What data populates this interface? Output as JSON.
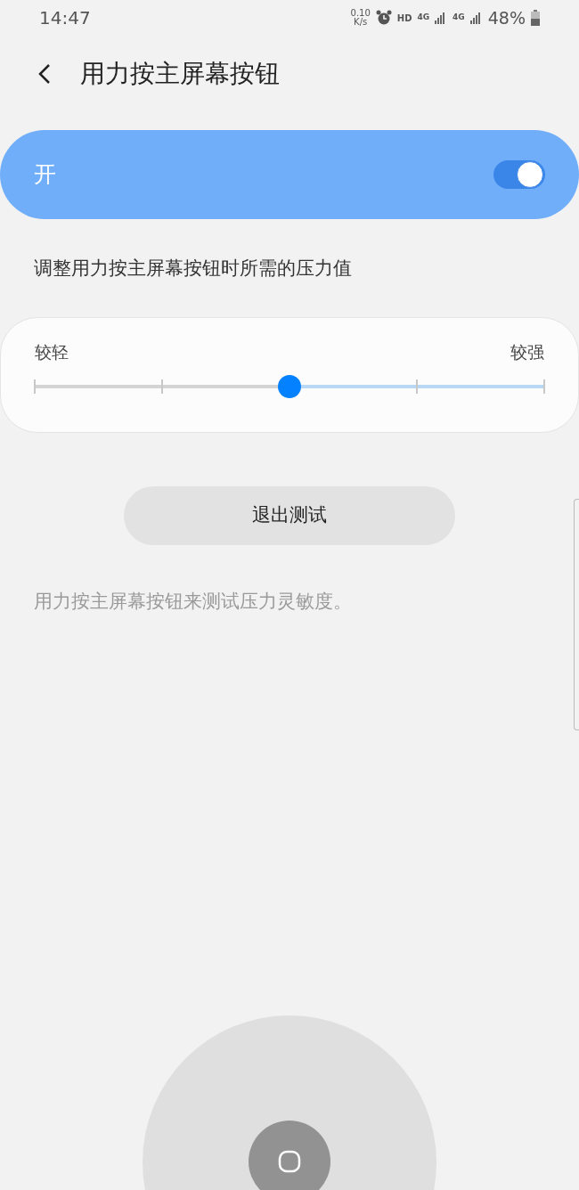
{
  "status_bar": {
    "time": "14:47",
    "net_speed": "0.10",
    "net_unit": "K/s",
    "hd": "HD",
    "network_1": "4G",
    "network_2": "4G",
    "battery": "48%"
  },
  "header": {
    "title": "用力按主屏幕按钮"
  },
  "master_switch": {
    "label": "开",
    "on": true
  },
  "description": "调整用力按主屏幕按钮时所需的压力值",
  "slider": {
    "min_label": "较轻",
    "max_label": "较强",
    "level": 0.5
  },
  "exit_button": {
    "label": "退出测试"
  },
  "hint": "用力按主屏幕按钮来测试压力灵敏度。"
}
